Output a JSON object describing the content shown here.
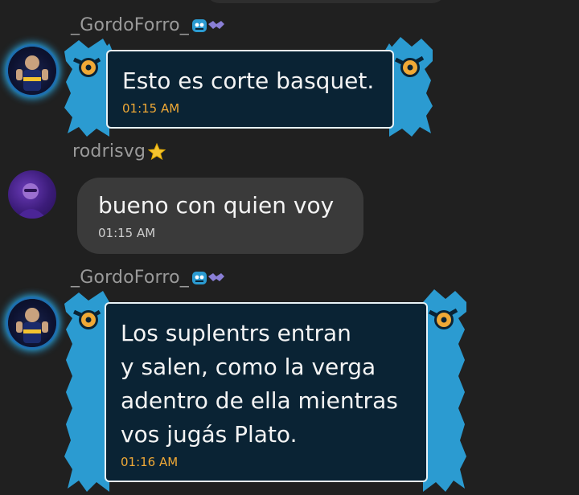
{
  "messages": [
    {
      "author": "_GordoForro_",
      "author_color": "#9a9a9a",
      "text": "Esto es corte basquet.",
      "time": "01:15 AM",
      "theme": "blue-monster"
    },
    {
      "author": "rodrisvg",
      "author_color": "#9a9a9a",
      "badge": "star-icon",
      "text": "bueno con quien voy",
      "time": "01:15 AM",
      "theme": "plain"
    },
    {
      "author": "_GordoForro_",
      "author_color": "#9a9a9a",
      "lines": [
        "Los suplentrs entran",
        "y salen, como la verga",
        "adentro de ella mientras",
        "vos jugás Plato."
      ],
      "time": "01:16 AM",
      "theme": "blue-monster"
    }
  ],
  "colors": {
    "background": "#202020",
    "theme_frame": "#2b9bd1",
    "theme_inner": "#0a2334",
    "theme_time": "#f0a936",
    "plain_bubble": "#3a3a3a"
  }
}
